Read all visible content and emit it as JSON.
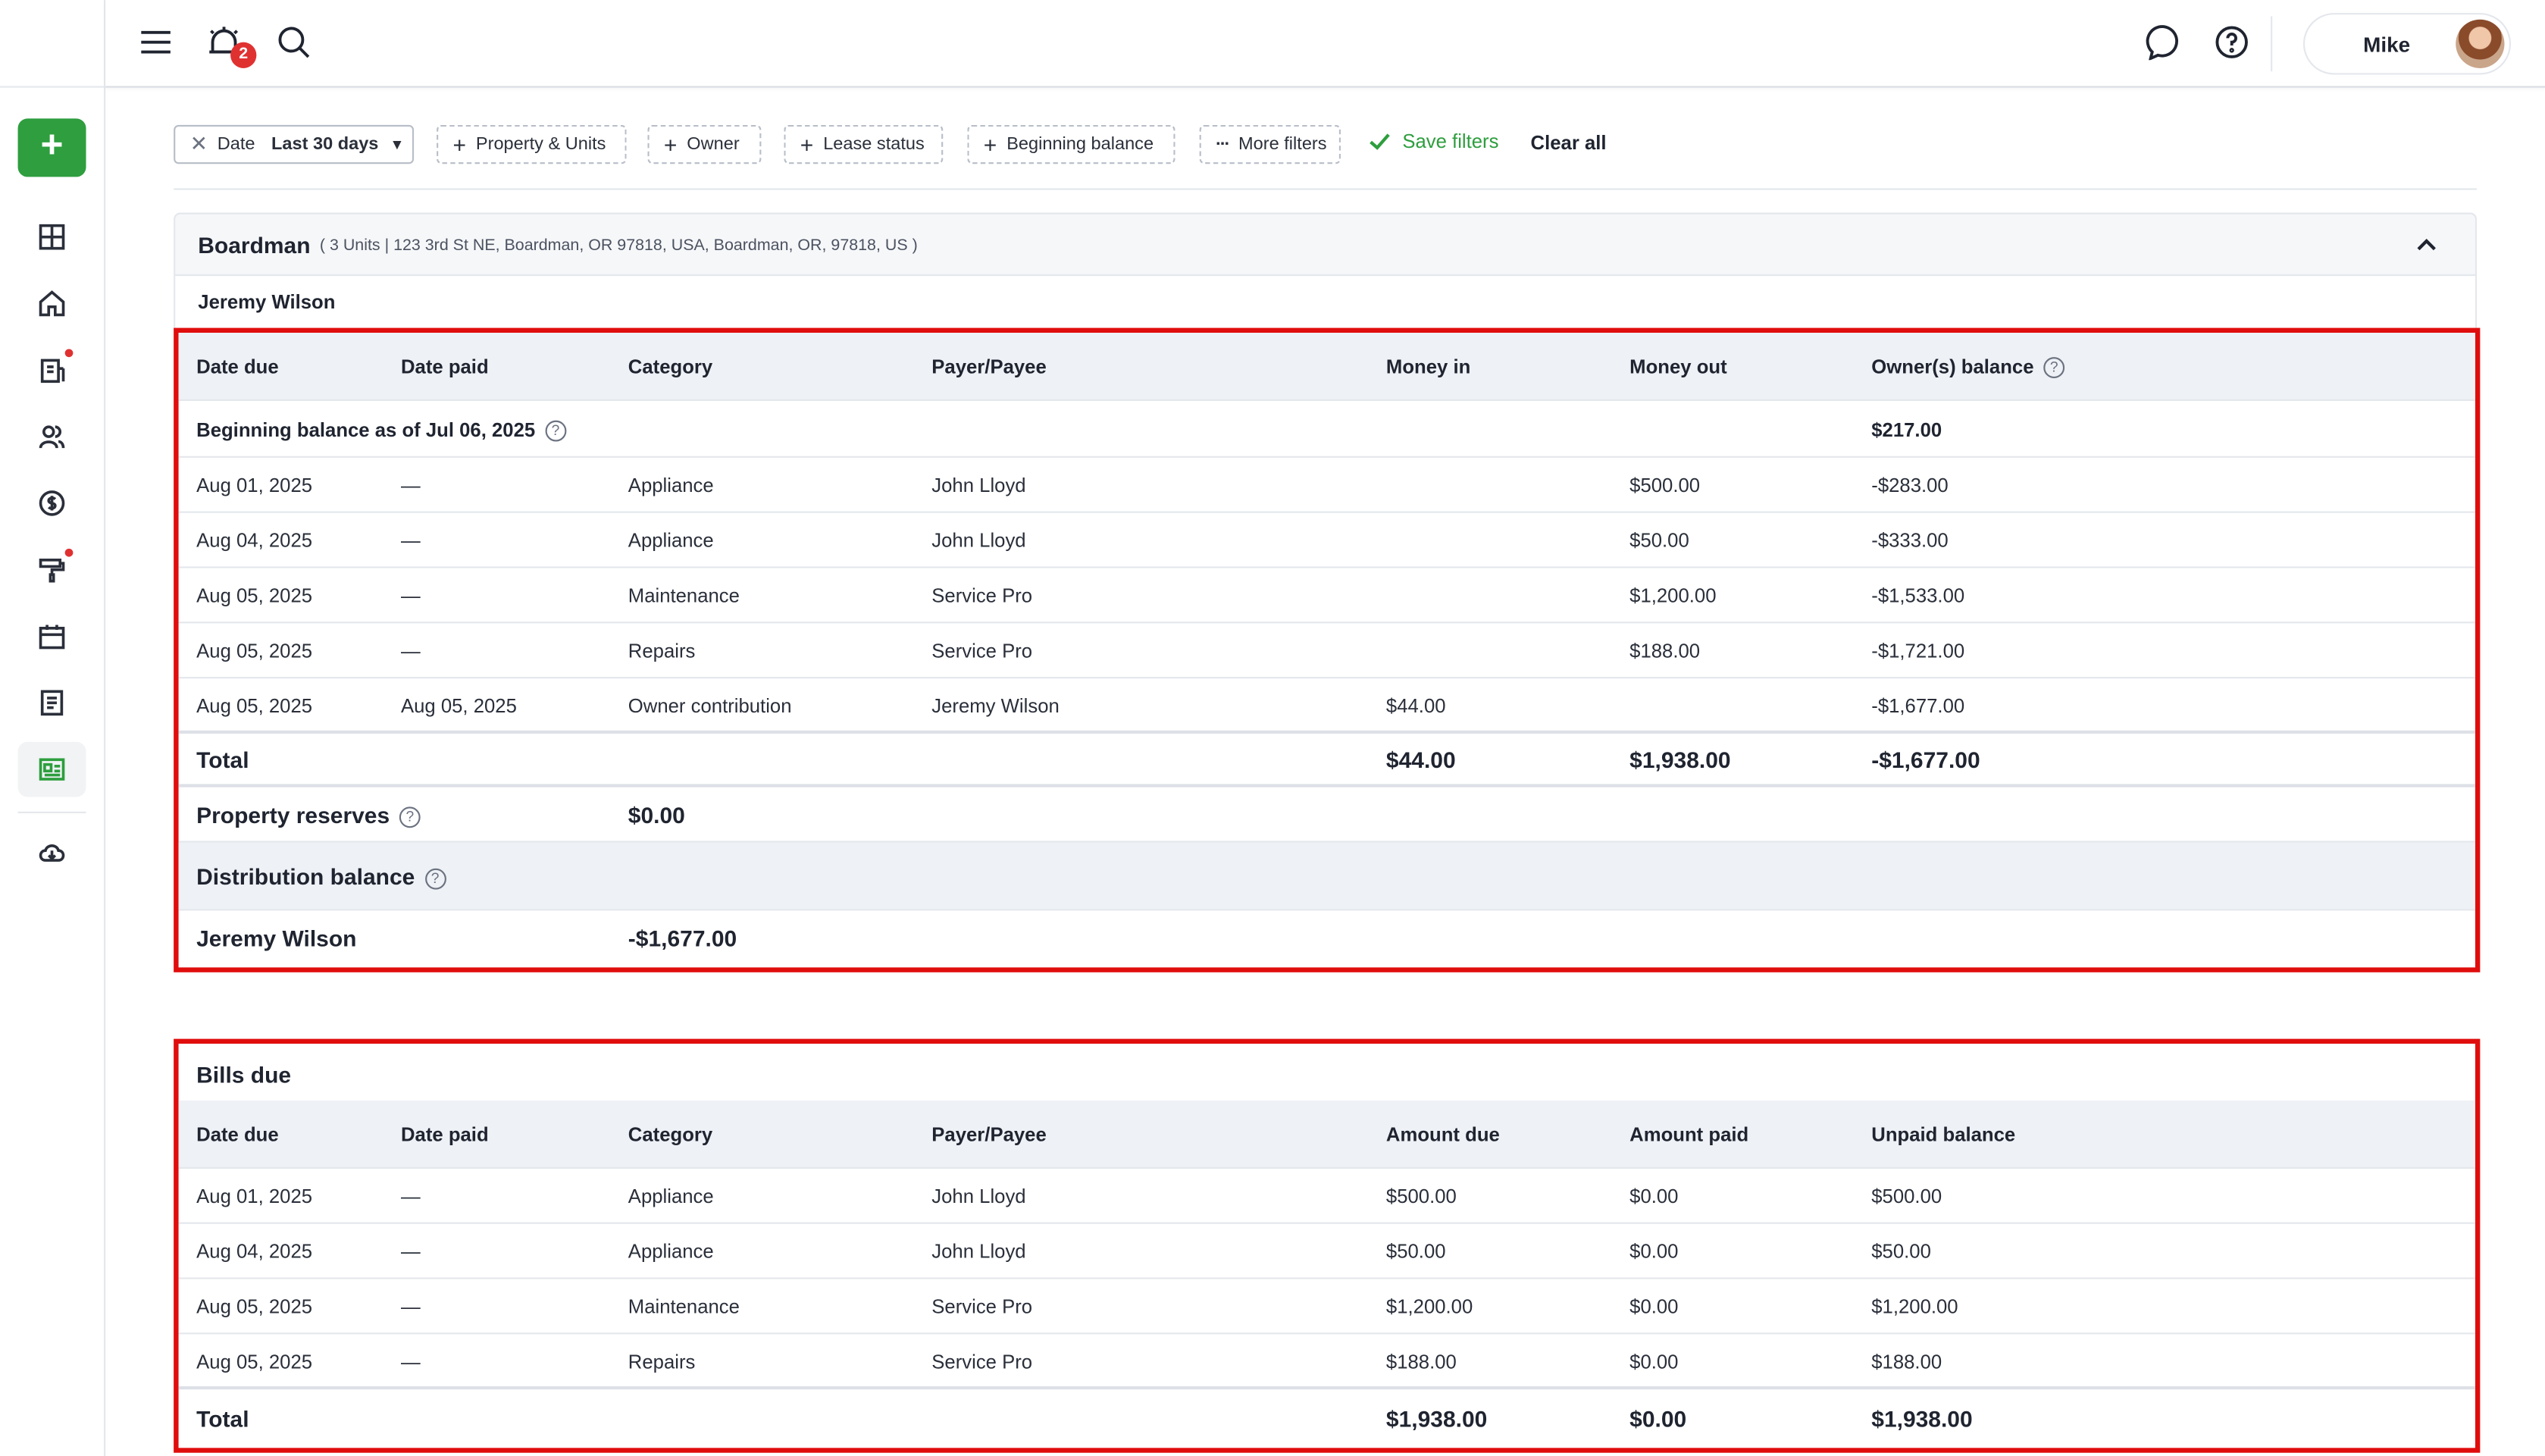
{
  "header": {
    "notification_count": "2",
    "user_name": "Mike"
  },
  "filters": {
    "date_label": "Date",
    "date_value": "Last 30 days",
    "chips": [
      "Property & Units",
      "Owner",
      "Lease status",
      "Beginning balance"
    ],
    "more_filters": "More filters",
    "save_filters": "Save filters",
    "clear_all": "Clear all"
  },
  "property": {
    "name": "Boardman",
    "address": "( 3 Units | 123 3rd St NE, Boardman, OR 97818, USA, Boardman, OR, 97818, US )",
    "owner": "Jeremy Wilson"
  },
  "ledger": {
    "columns": [
      "Date due",
      "Date paid",
      "Category",
      "Payer/Payee",
      "Money in",
      "Money out",
      "Owner(s) balance"
    ],
    "beginning_label": "Beginning balance as of Jul 06, 2025",
    "beginning_value": "$217.00",
    "rows": [
      {
        "date_due": "Aug 01, 2025",
        "date_paid": "—",
        "category": "Appliance",
        "payee": "John Lloyd",
        "money_in": "",
        "money_out": "$500.00",
        "balance": "-$283.00"
      },
      {
        "date_due": "Aug 04, 2025",
        "date_paid": "—",
        "category": "Appliance",
        "payee": "John Lloyd",
        "money_in": "",
        "money_out": "$50.00",
        "balance": "-$333.00"
      },
      {
        "date_due": "Aug 05, 2025",
        "date_paid": "—",
        "category": "Maintenance",
        "payee": "Service Pro",
        "money_in": "",
        "money_out": "$1,200.00",
        "balance": "-$1,533.00"
      },
      {
        "date_due": "Aug 05, 2025",
        "date_paid": "—",
        "category": "Repairs",
        "payee": "Service Pro",
        "money_in": "",
        "money_out": "$188.00",
        "balance": "-$1,721.00"
      },
      {
        "date_due": "Aug 05, 2025",
        "date_paid": "Aug 05, 2025",
        "category": "Owner contribution",
        "payee": "Jeremy Wilson",
        "money_in": "$44.00",
        "money_out": "",
        "balance": "-$1,677.00"
      }
    ],
    "total_label": "Total",
    "total_in": "$44.00",
    "total_out": "$1,938.00",
    "total_balance": "-$1,677.00",
    "reserves_label": "Property reserves",
    "reserves_value": "$0.00",
    "distribution_label": "Distribution balance",
    "dist_owner": "Jeremy Wilson",
    "dist_value": "-$1,677.00"
  },
  "bills": {
    "title": "Bills due",
    "columns": [
      "Date due",
      "Date paid",
      "Category",
      "Payer/Payee",
      "Amount due",
      "Amount paid",
      "Unpaid balance"
    ],
    "rows": [
      {
        "date_due": "Aug 01, 2025",
        "date_paid": "—",
        "category": "Appliance",
        "payee": "John Lloyd",
        "due": "$500.00",
        "paid": "$0.00",
        "unpaid": "$500.00"
      },
      {
        "date_due": "Aug 04, 2025",
        "date_paid": "—",
        "category": "Appliance",
        "payee": "John Lloyd",
        "due": "$50.00",
        "paid": "$0.00",
        "unpaid": "$50.00"
      },
      {
        "date_due": "Aug 05, 2025",
        "date_paid": "—",
        "category": "Maintenance",
        "payee": "Service Pro",
        "due": "$1,200.00",
        "paid": "$0.00",
        "unpaid": "$1,200.00"
      },
      {
        "date_due": "Aug 05, 2025",
        "date_paid": "—",
        "category": "Repairs",
        "payee": "Service Pro",
        "due": "$188.00",
        "paid": "$0.00",
        "unpaid": "$188.00"
      }
    ],
    "total_label": "Total",
    "total_due": "$1,938.00",
    "total_paid": "$0.00",
    "total_unpaid": "$1,938.00"
  }
}
